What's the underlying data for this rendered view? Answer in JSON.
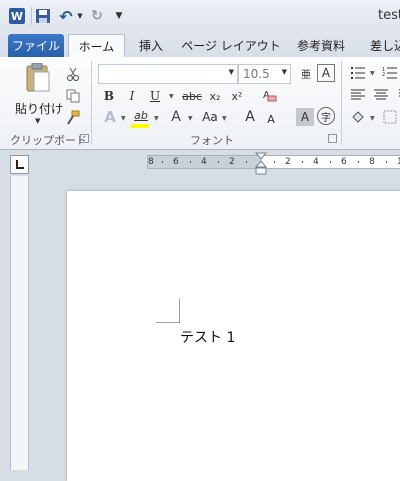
{
  "titlebar": {
    "app_logo": "W",
    "doc_title": "test",
    "icons": [
      "word-logo-icon",
      "save-icon",
      "undo-icon",
      "redo-icon",
      "customize-toolbar-icon"
    ]
  },
  "tabs": [
    {
      "label": "ファイル",
      "id": "file"
    },
    {
      "label": "ホーム",
      "id": "home"
    },
    {
      "label": "挿入",
      "id": "insert"
    },
    {
      "label": "ページ レイアウト",
      "id": "layout"
    },
    {
      "label": "参考資料",
      "id": "references"
    },
    {
      "label": "差し込",
      "id": "mailings"
    }
  ],
  "ribbon": {
    "clipboard": {
      "paste_label": "貼り付け",
      "group_label": "クリップボード"
    },
    "font": {
      "font_name": "",
      "font_size": "10.5",
      "group_label": "フォント",
      "bold": "B",
      "italic": "I",
      "underline": "U",
      "strike": "abc",
      "subscript": "x₂",
      "superscript": "x²",
      "text_effect": "A",
      "highlight": "ab",
      "font_color": "A",
      "change_case": "Aa",
      "grow": "A",
      "shrink": "A",
      "char_shading": "A",
      "enclose": "字",
      "phonetic": "亜",
      "char_border": "A",
      "clear": "A"
    }
  },
  "ruler": {
    "ticks": [
      "8",
      "6",
      "4",
      "2",
      "2",
      "4",
      "6",
      "8",
      "1"
    ]
  },
  "document": {
    "text": "テスト 1"
  },
  "colors": {
    "file_tab": "#2a5faa",
    "highlight_yellow": "#ffff00",
    "font_red": "#d02020"
  }
}
